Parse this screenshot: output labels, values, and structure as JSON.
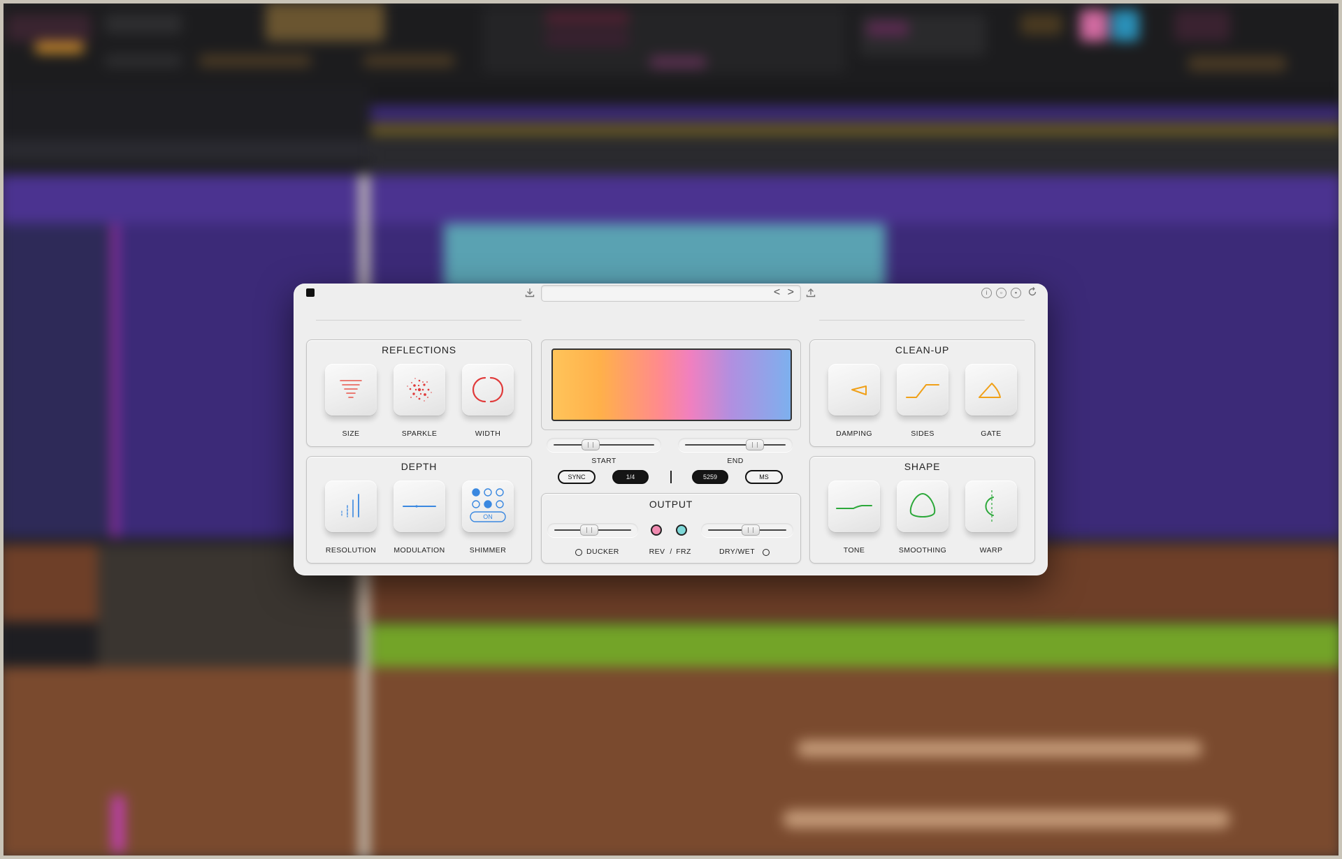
{
  "plugin": {
    "preset_name": "",
    "nav_arrows": "< >",
    "header_icons": [
      "download-icon",
      "upload-icon",
      "info-icon",
      "copy-icon",
      "save-icon",
      "reset-icon"
    ],
    "reflections": {
      "title": "REFLECTIONS",
      "knobs": [
        {
          "label": "SIZE",
          "icon": "size-icon",
          "color": "#e8554a"
        },
        {
          "label": "SPARKLE",
          "icon": "sparkle-icon",
          "color": "#e03a3a"
        },
        {
          "label": "WIDTH",
          "icon": "width-icon",
          "color": "#e03a3a"
        }
      ]
    },
    "depth": {
      "title": "DEPTH",
      "knobs": [
        {
          "label": "RESOLUTION",
          "icon": "resolution-icon",
          "color": "#3a88e0"
        },
        {
          "label": "MODULATION",
          "icon": "modulation-icon",
          "color": "#3a88e0"
        },
        {
          "label": "SHIMMER",
          "icon": "shimmer-icon",
          "color": "#3a88e0",
          "badge": "ON"
        }
      ]
    },
    "cleanup": {
      "title": "CLEAN-UP",
      "knobs": [
        {
          "label": "DAMPING",
          "icon": "damping-icon",
          "color": "#f0a018"
        },
        {
          "label": "SIDES",
          "icon": "sides-icon",
          "color": "#f0a018"
        },
        {
          "label": "GATE",
          "icon": "gate-icon",
          "color": "#f0a018"
        }
      ]
    },
    "shape": {
      "title": "SHAPE",
      "knobs": [
        {
          "label": "TONE",
          "icon": "tone-icon",
          "color": "#2ca83a"
        },
        {
          "label": "SMOOTHING",
          "icon": "smoothing-icon",
          "color": "#2ca83a"
        },
        {
          "label": "WARP",
          "icon": "warp-icon",
          "color": "#2ca83a"
        }
      ]
    },
    "display": {
      "start_label": "START",
      "end_label": "END",
      "start_value": 0.35,
      "end_value": 0.72,
      "sync_label": "SYNC",
      "division_label": "1/4",
      "ms_value": "5259",
      "ms_label": "MS",
      "gradient_colors": [
        "#ffc45a",
        "#ff8a8e",
        "#f080c0",
        "#7db0ee"
      ]
    },
    "output": {
      "title": "OUTPUT",
      "ducker_label": "DUCKER",
      "rev_label": "REV",
      "slash": "/",
      "frz_label": "FRZ",
      "drywet_label": "DRY/WET",
      "ducker_value": 0.45,
      "drywet_value": 0.55,
      "rev_color": "#f08ab0",
      "frz_color": "#7ed8d8"
    }
  }
}
